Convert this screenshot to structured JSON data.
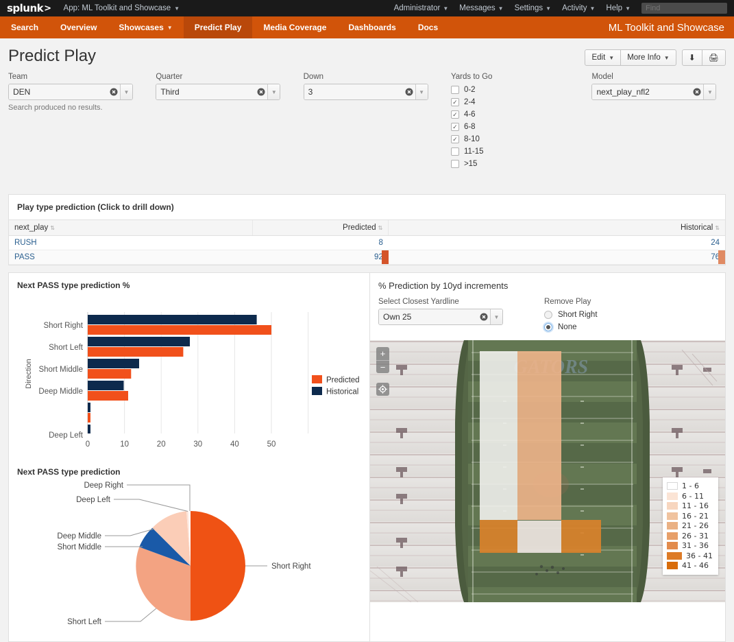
{
  "topbar": {
    "logo": "splunk",
    "logo_mark": ">",
    "app_menu": "App: ML Toolkit and Showcase",
    "right_items": [
      "Administrator",
      "Messages",
      "Settings",
      "Activity",
      "Help"
    ],
    "find_placeholder": "Find"
  },
  "nav": {
    "items": [
      {
        "label": "Search",
        "has_caret": false,
        "active": false
      },
      {
        "label": "Overview",
        "has_caret": false,
        "active": false
      },
      {
        "label": "Showcases",
        "has_caret": true,
        "active": false
      },
      {
        "label": "Predict Play",
        "has_caret": false,
        "active": true
      },
      {
        "label": "Media Coverage",
        "has_caret": false,
        "active": false
      },
      {
        "label": "Dashboards",
        "has_caret": false,
        "active": false
      },
      {
        "label": "Docs",
        "has_caret": false,
        "active": false
      }
    ],
    "app_title": "ML Toolkit and Showcase"
  },
  "page": {
    "title": "Predict Play",
    "actions": {
      "edit": "Edit",
      "more_info": "More Info",
      "export_icon": "download-icon",
      "print_icon": "print-icon"
    }
  },
  "filters": {
    "team": {
      "label": "Team",
      "value": "DEN",
      "message": "Search produced no results."
    },
    "quarter": {
      "label": "Quarter",
      "value": "Third"
    },
    "down": {
      "label": "Down",
      "value": "3"
    },
    "yards": {
      "label": "Yards to Go",
      "options": [
        {
          "label": "0-2",
          "checked": false
        },
        {
          "label": "2-4",
          "checked": true
        },
        {
          "label": "4-6",
          "checked": true
        },
        {
          "label": "6-8",
          "checked": true
        },
        {
          "label": "8-10",
          "checked": true
        },
        {
          "label": "11-15",
          "checked": false
        },
        {
          "label": ">15",
          "checked": false
        }
      ]
    },
    "model": {
      "label": "Model",
      "value": "next_play_nfl2"
    }
  },
  "play_table": {
    "title": "Play type prediction (Click to drill down)",
    "columns": [
      "next_play",
      "Predicted",
      "Historical"
    ],
    "rows": [
      {
        "next_play": "RUSH",
        "predicted": "8",
        "historical": "24",
        "pred_bar": 8,
        "hist_bar": 24
      },
      {
        "next_play": "PASS",
        "predicted": "92",
        "historical": "76",
        "pred_bar": 92,
        "hist_bar": 76
      }
    ]
  },
  "bar_panel": {
    "title": "Next PASS type prediction %"
  },
  "pie_panel": {
    "title": "Next PASS type prediction"
  },
  "map_panel": {
    "title": "% Prediction by 10yd increments",
    "yardline": {
      "label": "Select Closest Yardline",
      "value": "Own 25"
    },
    "remove_play": {
      "label": "Remove Play",
      "options": [
        {
          "label": "Short Right",
          "selected": false
        },
        {
          "label": "None",
          "selected": true
        }
      ]
    },
    "controls": {
      "zoom_in": "+",
      "zoom_out": "−",
      "locate": "locate-icon"
    },
    "field_text": "GATORS",
    "legend": [
      {
        "label": "1 - 6",
        "color": "#ffffff"
      },
      {
        "label": "6 - 11",
        "color": "#fbe4d5"
      },
      {
        "label": "11 - 16",
        "color": "#f7d6bf"
      },
      {
        "label": "16 - 21",
        "color": "#f0c39f"
      },
      {
        "label": "21 - 26",
        "color": "#eab184"
      },
      {
        "label": "26 - 31",
        "color": "#e79f69"
      },
      {
        "label": "31 - 36",
        "color": "#e28b4c"
      },
      {
        "label": "36 - 41",
        "color": "#dd7b27",
        "wide": true
      },
      {
        "label": "41 - 46",
        "color": "#d86c0a"
      }
    ],
    "overlays": [
      {
        "name": "left-column",
        "color": "#f0efec",
        "opacity": 0.85
      },
      {
        "name": "middle-column",
        "color": "#eeb48a",
        "opacity": 0.85
      },
      {
        "name": "bottom-left-zone",
        "color": "#d9822b",
        "opacity": 0.9
      },
      {
        "name": "bottom-mid-zone",
        "color": "#ece4df",
        "opacity": 0.9
      },
      {
        "name": "bottom-right-zone",
        "color": "#d9822b",
        "opacity": 0.9
      }
    ]
  },
  "colors": {
    "brand_orange": "#d1540a",
    "predicted": "#f1501b",
    "historical": "#0d2a4d",
    "pie_short_right": "#ef5214",
    "pie_short_left": "#f3a382",
    "pie_short_middle": "#1a5aa8",
    "pie_deep_middle": "#fbcdb7"
  },
  "chart_data": [
    {
      "type": "bar",
      "orientation": "horizontal",
      "title": "Next PASS type prediction %",
      "ylabel": "Direction",
      "xlabel": "",
      "categories": [
        "Short Right",
        "Short Left",
        "Short Middle",
        "Deep Middle",
        "Deep Right",
        "Deep Left"
      ],
      "tick_labels_shown": [
        "Short Right",
        "Short Left",
        "Short Middle",
        "Deep Middle",
        "",
        "Deep Left"
      ],
      "series": [
        {
          "name": "Predicted",
          "color": "#f1501b",
          "values": [
            50,
            26,
            11.8,
            11,
            0.6,
            0
          ]
        },
        {
          "name": "Historical",
          "color": "#0d2a4d",
          "values": [
            46,
            27.8,
            14,
            9.8,
            0.6,
            0.6
          ]
        }
      ],
      "xlim": [
        0,
        55
      ],
      "xticks": [
        0,
        10,
        20,
        30,
        40,
        50
      ],
      "grid": true,
      "legend_position": "right"
    },
    {
      "type": "pie",
      "title": "Next PASS type prediction",
      "labels": [
        "Short Right",
        "Deep Right",
        "Deep Left",
        "Deep Middle",
        "Short Middle",
        "Short Left"
      ],
      "values": [
        50,
        0.5,
        0.6,
        11,
        11.8,
        26
      ],
      "colors": [
        "#ef5214",
        "#ffffff",
        "#fde6db",
        "#fbcdb7",
        "#1a5aa8",
        "#f3a382"
      ],
      "label_positions": [
        "right",
        "left",
        "left",
        "left",
        "left",
        "left"
      ]
    }
  ]
}
